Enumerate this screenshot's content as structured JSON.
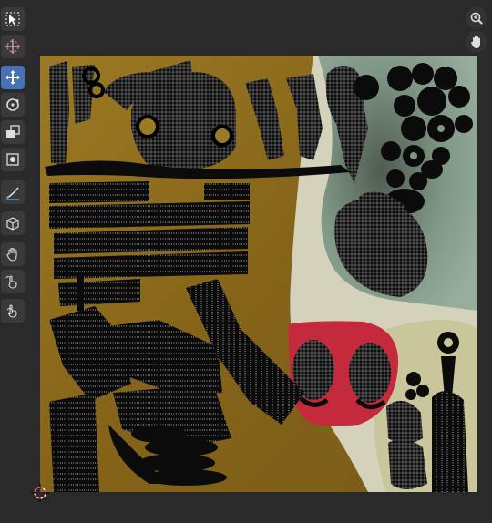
{
  "toolbar": {
    "tools": [
      {
        "name": "select-box-tool",
        "active": false
      },
      {
        "name": "cursor-tool",
        "active": false
      },
      {
        "name": "move-tool",
        "active": true
      },
      {
        "name": "rotate-tool",
        "active": false
      },
      {
        "name": "scale-tool",
        "active": false
      },
      {
        "name": "transform-tool",
        "active": false
      },
      {
        "name": "annotate-tool",
        "active": false
      },
      {
        "name": "uv-cube-tool",
        "active": false
      },
      {
        "name": "grab-tool",
        "active": false
      },
      {
        "name": "relax-tool",
        "active": false
      },
      {
        "name": "pinch-tool",
        "active": false
      }
    ]
  },
  "navigation": {
    "zoom_icon": "zoom-icon",
    "pan_icon": "hand-pan-icon"
  },
  "colors": {
    "background": "#2a2a2a",
    "active_tool": "#4772b3",
    "texture_ochre": "#8a6a1e",
    "texture_sage": "#8fa592",
    "texture_cream": "#d8d6c0",
    "texture_red": "#c8283c"
  }
}
